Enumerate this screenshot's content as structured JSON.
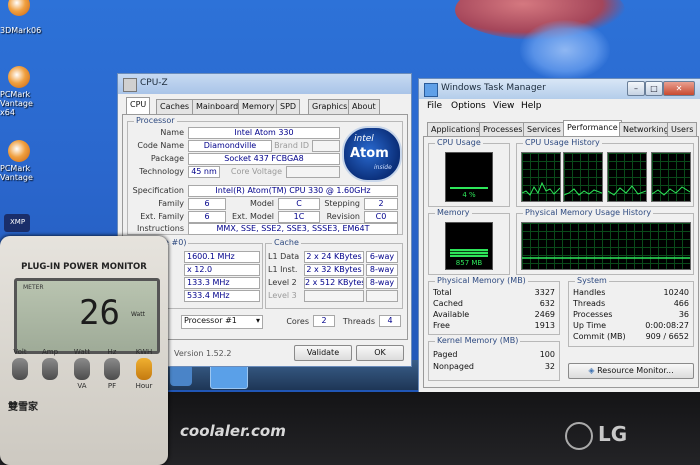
{
  "desktop_icons": [
    {
      "label": "3DMark06"
    },
    {
      "label": "PCMark Vantage x64"
    },
    {
      "label": "PCMark Vantage"
    },
    {
      "label": "XMP"
    }
  ],
  "cpuz": {
    "title": "CPU-Z",
    "tabs": [
      "CPU",
      "Caches",
      "Mainboard",
      "Memory",
      "SPD",
      "Graphics",
      "About"
    ],
    "processor": {
      "group_label": "Processor",
      "name_label": "Name",
      "name": "Intel Atom 330",
      "codename_label": "Code Name",
      "codename": "Diamondville",
      "brandid_label": "Brand ID",
      "brandid": "",
      "package_label": "Package",
      "package": "Socket 437 FCBGA8",
      "technology_label": "Technology",
      "technology": "45 nm",
      "corevoltage_label": "Core Voltage",
      "corevoltage": "",
      "spec_label": "Specification",
      "spec": "Intel(R) Atom(TM) CPU  330  @ 1.60GHz",
      "family_label": "Family",
      "family": "6",
      "model_label": "Model",
      "model": "C",
      "stepping_label": "Stepping",
      "stepping": "2",
      "extfamily_label": "Ext. Family",
      "extfamily": "6",
      "extmodel_label": "Ext. Model",
      "extmodel": "1C",
      "revision_label": "Revision",
      "revision": "C0",
      "instructions_label": "Instructions",
      "instructions": "MMX, SSE, SSE2, SSE3, SSSE3, EM64T",
      "logo_brand": "intel",
      "logo_product": "Atom",
      "logo_tag": "inside"
    },
    "clocks": {
      "group_label": "ks (Core #0)",
      "core_label": "ed",
      "core": "1600.1 MHz",
      "mult_label": "er",
      "mult": "x 12.0",
      "bus_label": "ed",
      "bus": "133.3 MHz",
      "fsb_label": "SB",
      "fsb": "533.4 MHz"
    },
    "cache": {
      "group_label": "Cache",
      "l1d_label": "L1 Data",
      "l1d": "2 x 24 KBytes",
      "l1d_way": "6-way",
      "l1i_label": "L1 Inst.",
      "l1i": "2 x 32 KBytes",
      "l1i_way": "8-way",
      "l2_label": "Level 2",
      "l2": "2 x 512 KBytes",
      "l2_way": "8-way",
      "l3_label": "Level 3",
      "l3": "",
      "l3_way": ""
    },
    "selection_label": "on",
    "selection": "Processor #1",
    "cores_label": "Cores",
    "cores": "2",
    "threads_label": "Threads",
    "threads": "4",
    "version": "Version 1.52.2",
    "validate_label": "Validate",
    "ok_label": "OK"
  },
  "taskmgr": {
    "title": "Windows Task Manager",
    "menu": [
      "File",
      "Options",
      "View",
      "Help"
    ],
    "tabs": [
      "Applications",
      "Processes",
      "Services",
      "Performance",
      "Networking",
      "Users"
    ],
    "cpu_usage_label": "CPU Usage",
    "cpu_usage_value": "4 %",
    "cpu_usage_fraction": 0.04,
    "cpu_history_label": "CPU Usage History",
    "memory_label": "Memory",
    "memory_value": "857 MB",
    "memory_fraction": 0.26,
    "mem_history_label": "Physical Memory Usage History",
    "physical_memory": {
      "label": "Physical Memory (MB)",
      "rows": [
        {
          "name": "Total",
          "value": "3327"
        },
        {
          "name": "Cached",
          "value": "632"
        },
        {
          "name": "Available",
          "value": "2469"
        },
        {
          "name": "Free",
          "value": "1913"
        }
      ]
    },
    "kernel_memory": {
      "label": "Kernel Memory (MB)",
      "rows": [
        {
          "name": "Paged",
          "value": "100"
        },
        {
          "name": "Nonpaged",
          "value": "32"
        }
      ]
    },
    "system": {
      "label": "System",
      "rows": [
        {
          "name": "Handles",
          "value": "10240"
        },
        {
          "name": "Threads",
          "value": "466"
        },
        {
          "name": "Processes",
          "value": "36"
        },
        {
          "name": "Up Time",
          "value": "0:00:08:27"
        },
        {
          "name": "Commit (MB)",
          "value": "909 / 6652"
        }
      ]
    },
    "resource_monitor_label": "Resource Monitor..."
  },
  "meter": {
    "title": "PLUG-IN POWER MONITOR",
    "screen_label": "METER",
    "reading": "26",
    "unit": "Watt",
    "buttons": [
      {
        "top": "Volt",
        "bottom": ""
      },
      {
        "top": "Amp",
        "bottom": ""
      },
      {
        "top": "Watt",
        "bottom": "VA"
      },
      {
        "top": "Hz",
        "bottom": "PF"
      },
      {
        "top": "KWH",
        "bottom": "Hour"
      }
    ],
    "brand": "雙雪家"
  },
  "watermark": "coolaler.com",
  "monitor_brand": "LG",
  "colors": {
    "graph_green": "#2ee65a",
    "graph_bg": "#000000",
    "cpuz_value": "#00008b",
    "desktop": "#2a66cc"
  }
}
